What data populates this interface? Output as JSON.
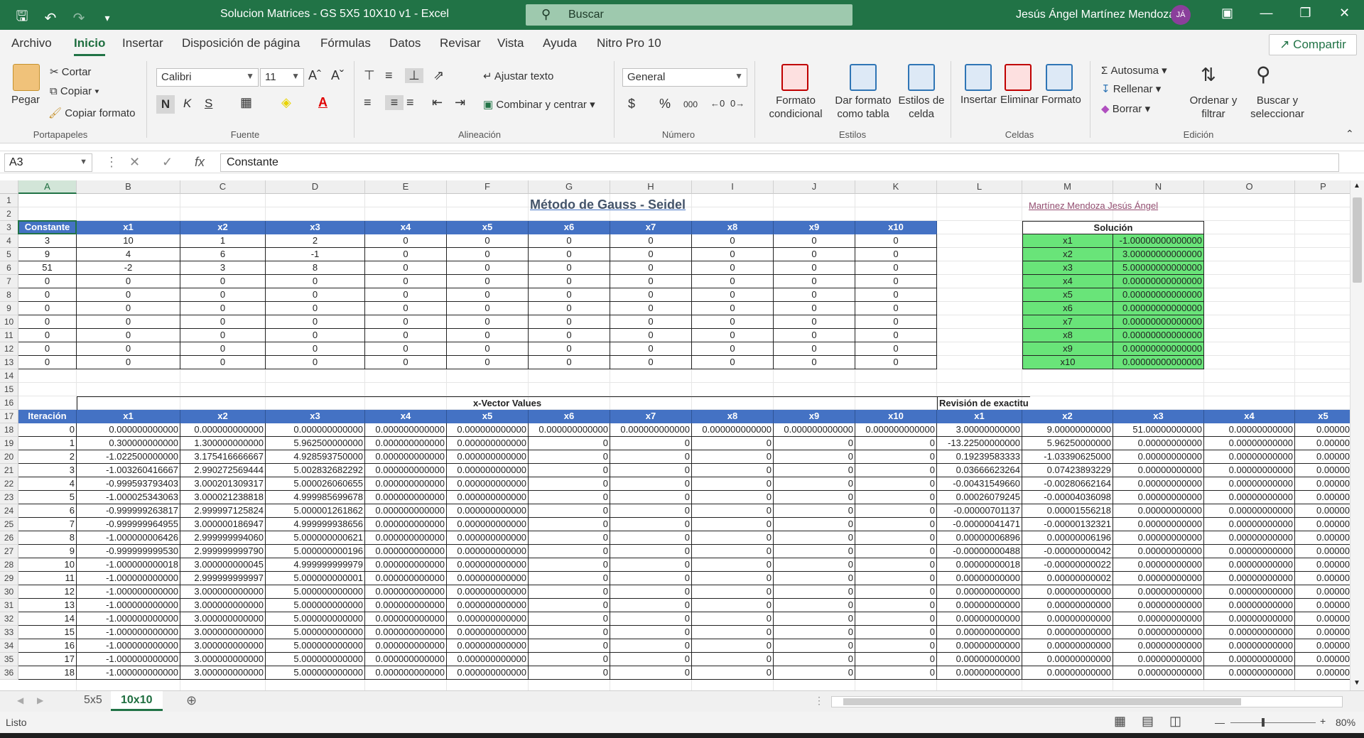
{
  "window": {
    "doc_title": "Solucion Matrices - GS 5X5 10X10 v1  -  Excel",
    "search_placeholder": "Buscar",
    "user_name": "Jesús Ángel Martínez Mendoza",
    "user_initials": "JÁ"
  },
  "menu": {
    "tabs": [
      "Archivo",
      "Inicio",
      "Insertar",
      "Disposición de página",
      "Fórmulas",
      "Datos",
      "Revisar",
      "Vista",
      "Ayuda",
      "Nitro Pro 10"
    ],
    "active": "Inicio",
    "share_label": "Compartir"
  },
  "ribbon": {
    "clipboard": {
      "paste": "Pegar",
      "cut": "Cortar",
      "copy": "Copiar",
      "format_painter": "Copiar formato",
      "label": "Portapapeles"
    },
    "font": {
      "name": "Calibri",
      "size": "11",
      "bold": "N",
      "italic": "K",
      "underline": "S",
      "label": "Fuente"
    },
    "alignment": {
      "wrap": "Ajustar texto",
      "merge": "Combinar y centrar",
      "label": "Alineación"
    },
    "number": {
      "format": "General",
      "label": "Número"
    },
    "styles": {
      "conditional": "Formato condicional",
      "as_table": "Dar formato como tabla",
      "cell_styles": "Estilos de celda",
      "label": "Estilos"
    },
    "cells": {
      "insert": "Insertar",
      "delete": "Eliminar",
      "format": "Formato",
      "label": "Celdas"
    },
    "editing": {
      "autosum": "Autosuma",
      "fill": "Rellenar",
      "clear": "Borrar",
      "sort": "Ordenar y filtrar",
      "find": "Buscar y seleccionar",
      "label": "Edición"
    }
  },
  "formula_bar": {
    "name_box": "A3",
    "content": "Constante"
  },
  "sheet": {
    "columns": [
      "A",
      "B",
      "C",
      "D",
      "E",
      "F",
      "G",
      "H",
      "I",
      "J",
      "K",
      "L",
      "M",
      "N",
      "O",
      "P"
    ],
    "rows": [
      "1",
      "2",
      "3",
      "4",
      "5",
      "6",
      "7",
      "8",
      "9",
      "10",
      "11",
      "12",
      "13",
      "14",
      "15",
      "16",
      "17",
      "18",
      "19",
      "20",
      "21",
      "22",
      "23",
      "24",
      "25",
      "26",
      "27",
      "28",
      "29",
      "30",
      "31",
      "32",
      "33",
      "34",
      "35",
      "36"
    ],
    "title": "Método de Gauss - Seidel",
    "author": "Martínez Mendoza Jesús Ángel",
    "matrix_headers": [
      "Constante",
      "x1",
      "x2",
      "x3",
      "x4",
      "x5",
      "x6",
      "x7",
      "x8",
      "x9",
      "x10"
    ],
    "matrix_rows": [
      [
        "3",
        "10",
        "1",
        "2",
        "0",
        "0",
        "0",
        "0",
        "0",
        "0",
        "0"
      ],
      [
        "9",
        "4",
        "6",
        "-1",
        "0",
        "0",
        "0",
        "0",
        "0",
        "0",
        "0"
      ],
      [
        "51",
        "-2",
        "3",
        "8",
        "0",
        "0",
        "0",
        "0",
        "0",
        "0",
        "0"
      ],
      [
        "0",
        "0",
        "0",
        "0",
        "0",
        "0",
        "0",
        "0",
        "0",
        "0",
        "0"
      ],
      [
        "0",
        "0",
        "0",
        "0",
        "0",
        "0",
        "0",
        "0",
        "0",
        "0",
        "0"
      ],
      [
        "0",
        "0",
        "0",
        "0",
        "0",
        "0",
        "0",
        "0",
        "0",
        "0",
        "0"
      ],
      [
        "0",
        "0",
        "0",
        "0",
        "0",
        "0",
        "0",
        "0",
        "0",
        "0",
        "0"
      ],
      [
        "0",
        "0",
        "0",
        "0",
        "0",
        "0",
        "0",
        "0",
        "0",
        "0",
        "0"
      ],
      [
        "0",
        "0",
        "0",
        "0",
        "0",
        "0",
        "0",
        "0",
        "0",
        "0",
        "0"
      ],
      [
        "0",
        "0",
        "0",
        "0",
        "0",
        "0",
        "0",
        "0",
        "0",
        "0",
        "0"
      ]
    ],
    "solution_title": "Solución",
    "solution": [
      [
        "x1",
        "-1.00000000000000"
      ],
      [
        "x2",
        "3.00000000000000"
      ],
      [
        "x3",
        "5.00000000000000"
      ],
      [
        "x4",
        "0.00000000000000"
      ],
      [
        "x5",
        "0.00000000000000"
      ],
      [
        "x6",
        "0.00000000000000"
      ],
      [
        "x7",
        "0.00000000000000"
      ],
      [
        "x8",
        "0.00000000000000"
      ],
      [
        "x9",
        "0.00000000000000"
      ],
      [
        "x10",
        "0.00000000000000"
      ]
    ],
    "xvector_title": "x-Vector Values",
    "review_title": "Revisión de exactitu",
    "iter_headers": [
      "Iteración",
      "x1",
      "x2",
      "x3",
      "x4",
      "x5",
      "x6",
      "x7",
      "x8",
      "x9",
      "x10",
      "x1",
      "x2",
      "x3",
      "x4",
      "x5"
    ],
    "iter_rows": [
      [
        "0",
        "0.000000000000",
        "0.000000000000",
        "0.000000000000",
        "0.000000000000",
        "0.000000000000",
        "0.000000000000",
        "0.000000000000",
        "0.000000000000",
        "0.000000000000",
        "0.000000000000",
        "3.00000000000",
        "9.00000000000",
        "51.00000000000",
        "0.00000000000",
        "0.00000"
      ],
      [
        "1",
        "0.300000000000",
        "1.300000000000",
        "5.962500000000",
        "0.000000000000",
        "0.000000000000",
        "0",
        "0",
        "0",
        "0",
        "0",
        "-13.22500000000",
        "5.96250000000",
        "0.00000000000",
        "0.00000000000",
        "0.00000"
      ],
      [
        "2",
        "-1.022500000000",
        "3.175416666667",
        "4.928593750000",
        "0.000000000000",
        "0.000000000000",
        "0",
        "0",
        "0",
        "0",
        "0",
        "0.19239583333",
        "-1.03390625000",
        "0.00000000000",
        "0.00000000000",
        "0.00000"
      ],
      [
        "3",
        "-1.003260416667",
        "2.990272569444",
        "5.002832682292",
        "0.000000000000",
        "0.000000000000",
        "0",
        "0",
        "0",
        "0",
        "0",
        "0.03666623264",
        "0.07423893229",
        "0.00000000000",
        "0.00000000000",
        "0.00000"
      ],
      [
        "4",
        "-0.999593793403",
        "3.000201309317",
        "5.000026060655",
        "0.000000000000",
        "0.000000000000",
        "0",
        "0",
        "0",
        "0",
        "0",
        "-0.00431549660",
        "-0.00280662164",
        "0.00000000000",
        "0.00000000000",
        "0.00000"
      ],
      [
        "5",
        "-1.000025343063",
        "3.000021238818",
        "4.999985699678",
        "0.000000000000",
        "0.000000000000",
        "0",
        "0",
        "0",
        "0",
        "0",
        "0.00026079245",
        "-0.00004036098",
        "0.00000000000",
        "0.00000000000",
        "0.00000"
      ],
      [
        "6",
        "-0.999999263817",
        "2.999997125824",
        "5.000001261862",
        "0.000000000000",
        "0.000000000000",
        "0",
        "0",
        "0",
        "0",
        "0",
        "-0.00000701137",
        "0.00001556218",
        "0.00000000000",
        "0.00000000000",
        "0.00000"
      ],
      [
        "7",
        "-0.999999964955",
        "3.000000186947",
        "4.999999938656",
        "0.000000000000",
        "0.000000000000",
        "0",
        "0",
        "0",
        "0",
        "0",
        "-0.00000041471",
        "-0.00000132321",
        "0.00000000000",
        "0.00000000000",
        "0.00000"
      ],
      [
        "8",
        "-1.000000006426",
        "2.999999994060",
        "5.000000000621",
        "0.000000000000",
        "0.000000000000",
        "0",
        "0",
        "0",
        "0",
        "0",
        "0.00000006896",
        "0.00000006196",
        "0.00000000000",
        "0.00000000000",
        "0.00000"
      ],
      [
        "9",
        "-0.999999999530",
        "2.999999999790",
        "5.000000000196",
        "0.000000000000",
        "0.000000000000",
        "0",
        "0",
        "0",
        "0",
        "0",
        "-0.00000000488",
        "-0.00000000042",
        "0.00000000000",
        "0.00000000000",
        "0.00000"
      ],
      [
        "10",
        "-1.000000000018",
        "3.000000000045",
        "4.999999999979",
        "0.000000000000",
        "0.000000000000",
        "0",
        "0",
        "0",
        "0",
        "0",
        "0.00000000018",
        "-0.00000000022",
        "0.00000000000",
        "0.00000000000",
        "0.00000"
      ],
      [
        "11",
        "-1.000000000000",
        "2.999999999997",
        "5.000000000001",
        "0.000000000000",
        "0.000000000000",
        "0",
        "0",
        "0",
        "0",
        "0",
        "0.00000000000",
        "0.00000000002",
        "0.00000000000",
        "0.00000000000",
        "0.00000"
      ],
      [
        "12",
        "-1.000000000000",
        "3.000000000000",
        "5.000000000000",
        "0.000000000000",
        "0.000000000000",
        "0",
        "0",
        "0",
        "0",
        "0",
        "0.00000000000",
        "0.00000000000",
        "0.00000000000",
        "0.00000000000",
        "0.00000"
      ],
      [
        "13",
        "-1.000000000000",
        "3.000000000000",
        "5.000000000000",
        "0.000000000000",
        "0.000000000000",
        "0",
        "0",
        "0",
        "0",
        "0",
        "0.00000000000",
        "0.00000000000",
        "0.00000000000",
        "0.00000000000",
        "0.00000"
      ],
      [
        "14",
        "-1.000000000000",
        "3.000000000000",
        "5.000000000000",
        "0.000000000000",
        "0.000000000000",
        "0",
        "0",
        "0",
        "0",
        "0",
        "0.00000000000",
        "0.00000000000",
        "0.00000000000",
        "0.00000000000",
        "0.00000"
      ],
      [
        "15",
        "-1.000000000000",
        "3.000000000000",
        "5.000000000000",
        "0.000000000000",
        "0.000000000000",
        "0",
        "0",
        "0",
        "0",
        "0",
        "0.00000000000",
        "0.00000000000",
        "0.00000000000",
        "0.00000000000",
        "0.00000"
      ],
      [
        "16",
        "-1.000000000000",
        "3.000000000000",
        "5.000000000000",
        "0.000000000000",
        "0.000000000000",
        "0",
        "0",
        "0",
        "0",
        "0",
        "0.00000000000",
        "0.00000000000",
        "0.00000000000",
        "0.00000000000",
        "0.00000"
      ],
      [
        "17",
        "-1.000000000000",
        "3.000000000000",
        "5.000000000000",
        "0.000000000000",
        "0.000000000000",
        "0",
        "0",
        "0",
        "0",
        "0",
        "0.00000000000",
        "0.00000000000",
        "0.00000000000",
        "0.00000000000",
        "0.00000"
      ],
      [
        "18",
        "-1.000000000000",
        "3.000000000000",
        "5.000000000000",
        "0.000000000000",
        "0.000000000000",
        "0",
        "0",
        "0",
        "0",
        "0",
        "0.00000000000",
        "0.00000000000",
        "0.00000000000",
        "0.00000000000",
        "0.00000"
      ]
    ]
  },
  "sheet_tabs": {
    "tabs": [
      "5x5",
      "10x10"
    ],
    "active": "10x10"
  },
  "status": {
    "ready": "Listo",
    "zoom": "80%"
  },
  "colors": {
    "excel_green": "#217346",
    "header_blue": "#4472c4",
    "solution_green": "#69e479"
  }
}
